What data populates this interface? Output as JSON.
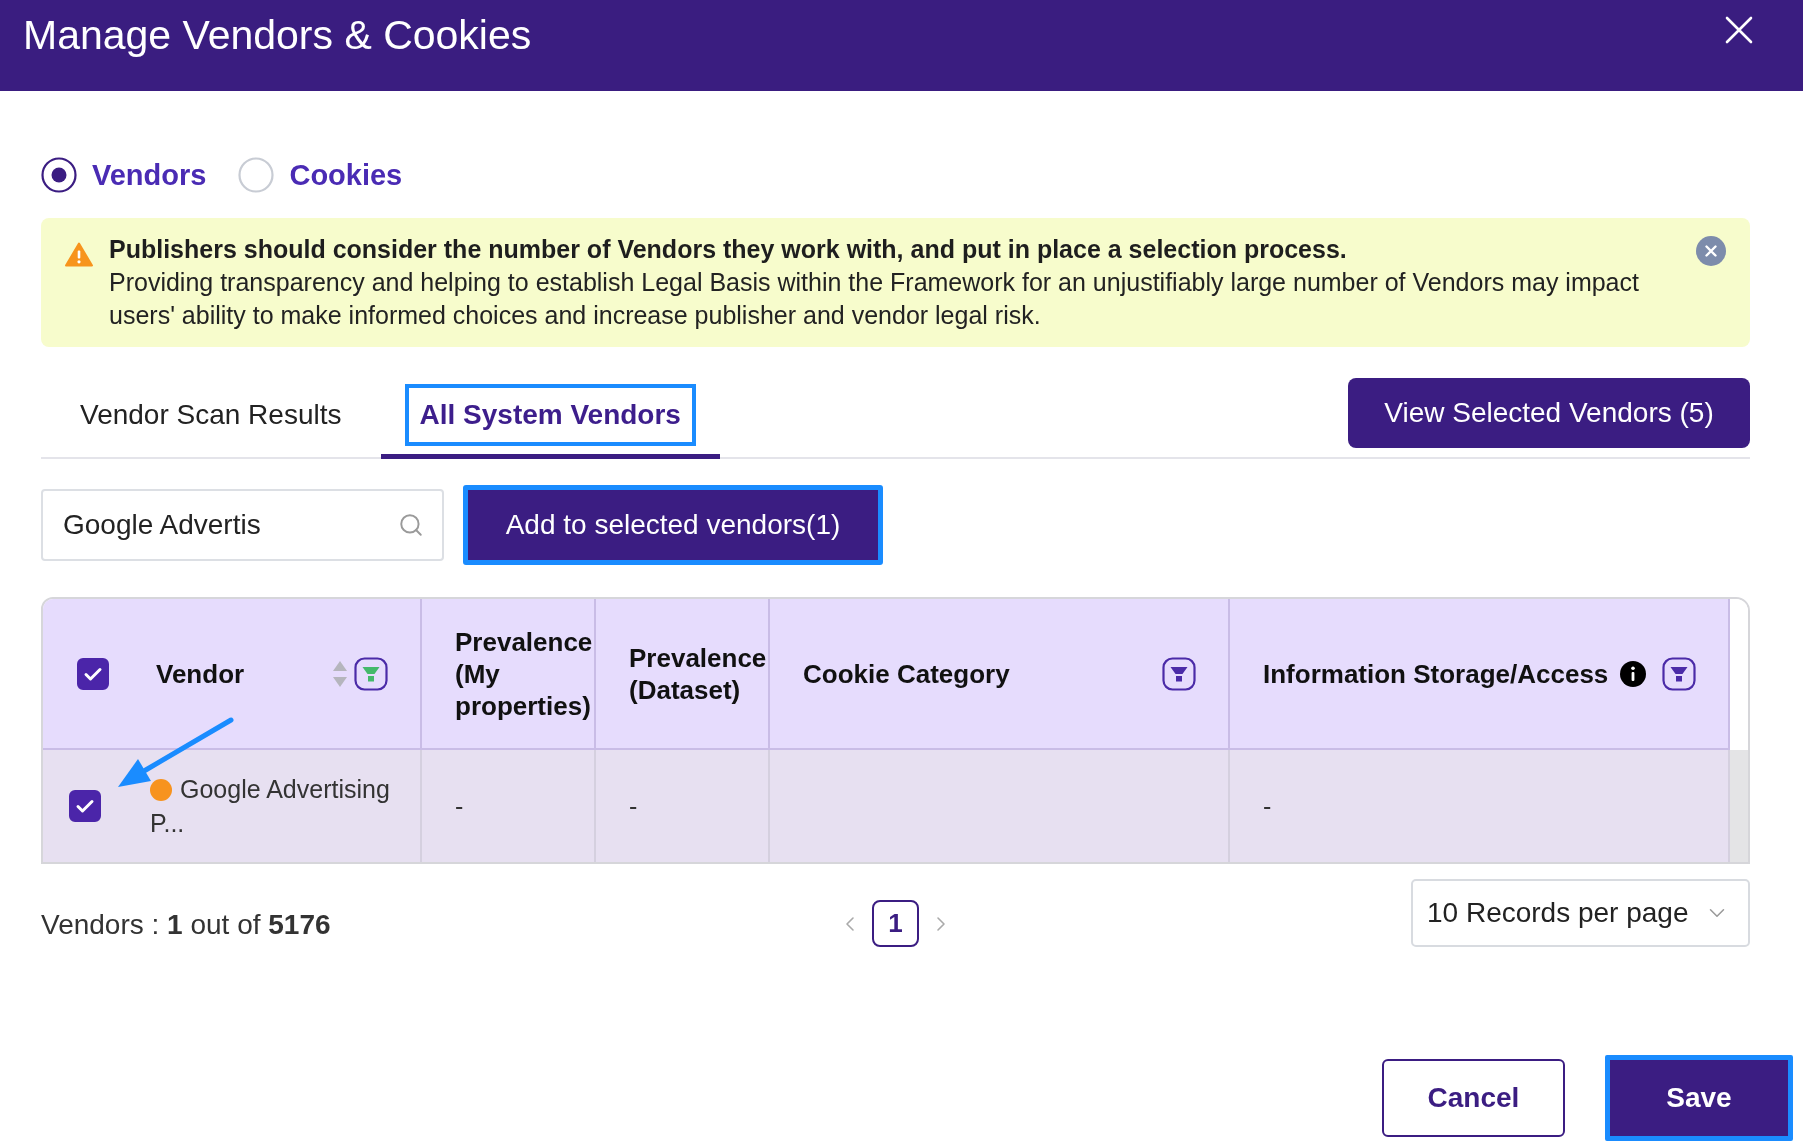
{
  "dialog": {
    "title": "Manage Vendors & Cookies"
  },
  "mode_options": [
    {
      "label": "Vendors",
      "selected": true
    },
    {
      "label": "Cookies",
      "selected": false
    }
  ],
  "alert": {
    "heading": "Publishers should consider the number of Vendors they work with, and put in place a selection process.",
    "message": "Providing transparency and helping to establish Legal Basis within the Framework for an unjustifiably large number of Vendors may impact users' ability to make informed choices and increase publisher and vendor legal risk."
  },
  "tabs": [
    {
      "label": "Vendor Scan Results",
      "selected": false,
      "highlighted": false
    },
    {
      "label": "All System Vendors",
      "selected": true,
      "highlighted": true
    }
  ],
  "view_selected_button": {
    "label": "View Selected Vendors (5)"
  },
  "search": {
    "value": "Google Advertis"
  },
  "add_button": {
    "label": "Add to selected vendors(1)",
    "highlighted": true
  },
  "table": {
    "select_all_checked": true,
    "columns": [
      {
        "label": "Vendor",
        "sortable": true,
        "info": false,
        "filterable": true,
        "filter_active": true
      },
      {
        "label": "Prevalence (My properties)",
        "sortable": false,
        "info": false,
        "filterable": false
      },
      {
        "label": "Prevalence (Dataset)",
        "sortable": false,
        "info": false,
        "filterable": false
      },
      {
        "label": "Cookie Category",
        "sortable": false,
        "info": false,
        "filterable": true,
        "filter_active": false
      },
      {
        "label": "Information Storage/Access",
        "sortable": false,
        "info": true,
        "filterable": true,
        "filter_active": false
      }
    ],
    "rows": [
      {
        "checked": true,
        "color": "#f7931e",
        "vendor": "Google Advertising P...",
        "prevalence_my_properties": "-",
        "prevalence_dataset": "-",
        "information_storage_access": "-"
      }
    ]
  },
  "summary": "Vendors : **1** out of **5176**",
  "pagination": {
    "pages": [
      {
        "label": "1",
        "selected": true
      }
    ]
  },
  "page_size": {
    "value": "10 Records per page"
  },
  "footer_buttons": [
    {
      "label": "Cancel",
      "kind": "secondary",
      "highlighted": false
    },
    {
      "label": "Save",
      "kind": "primary",
      "highlighted": true
    }
  ]
}
